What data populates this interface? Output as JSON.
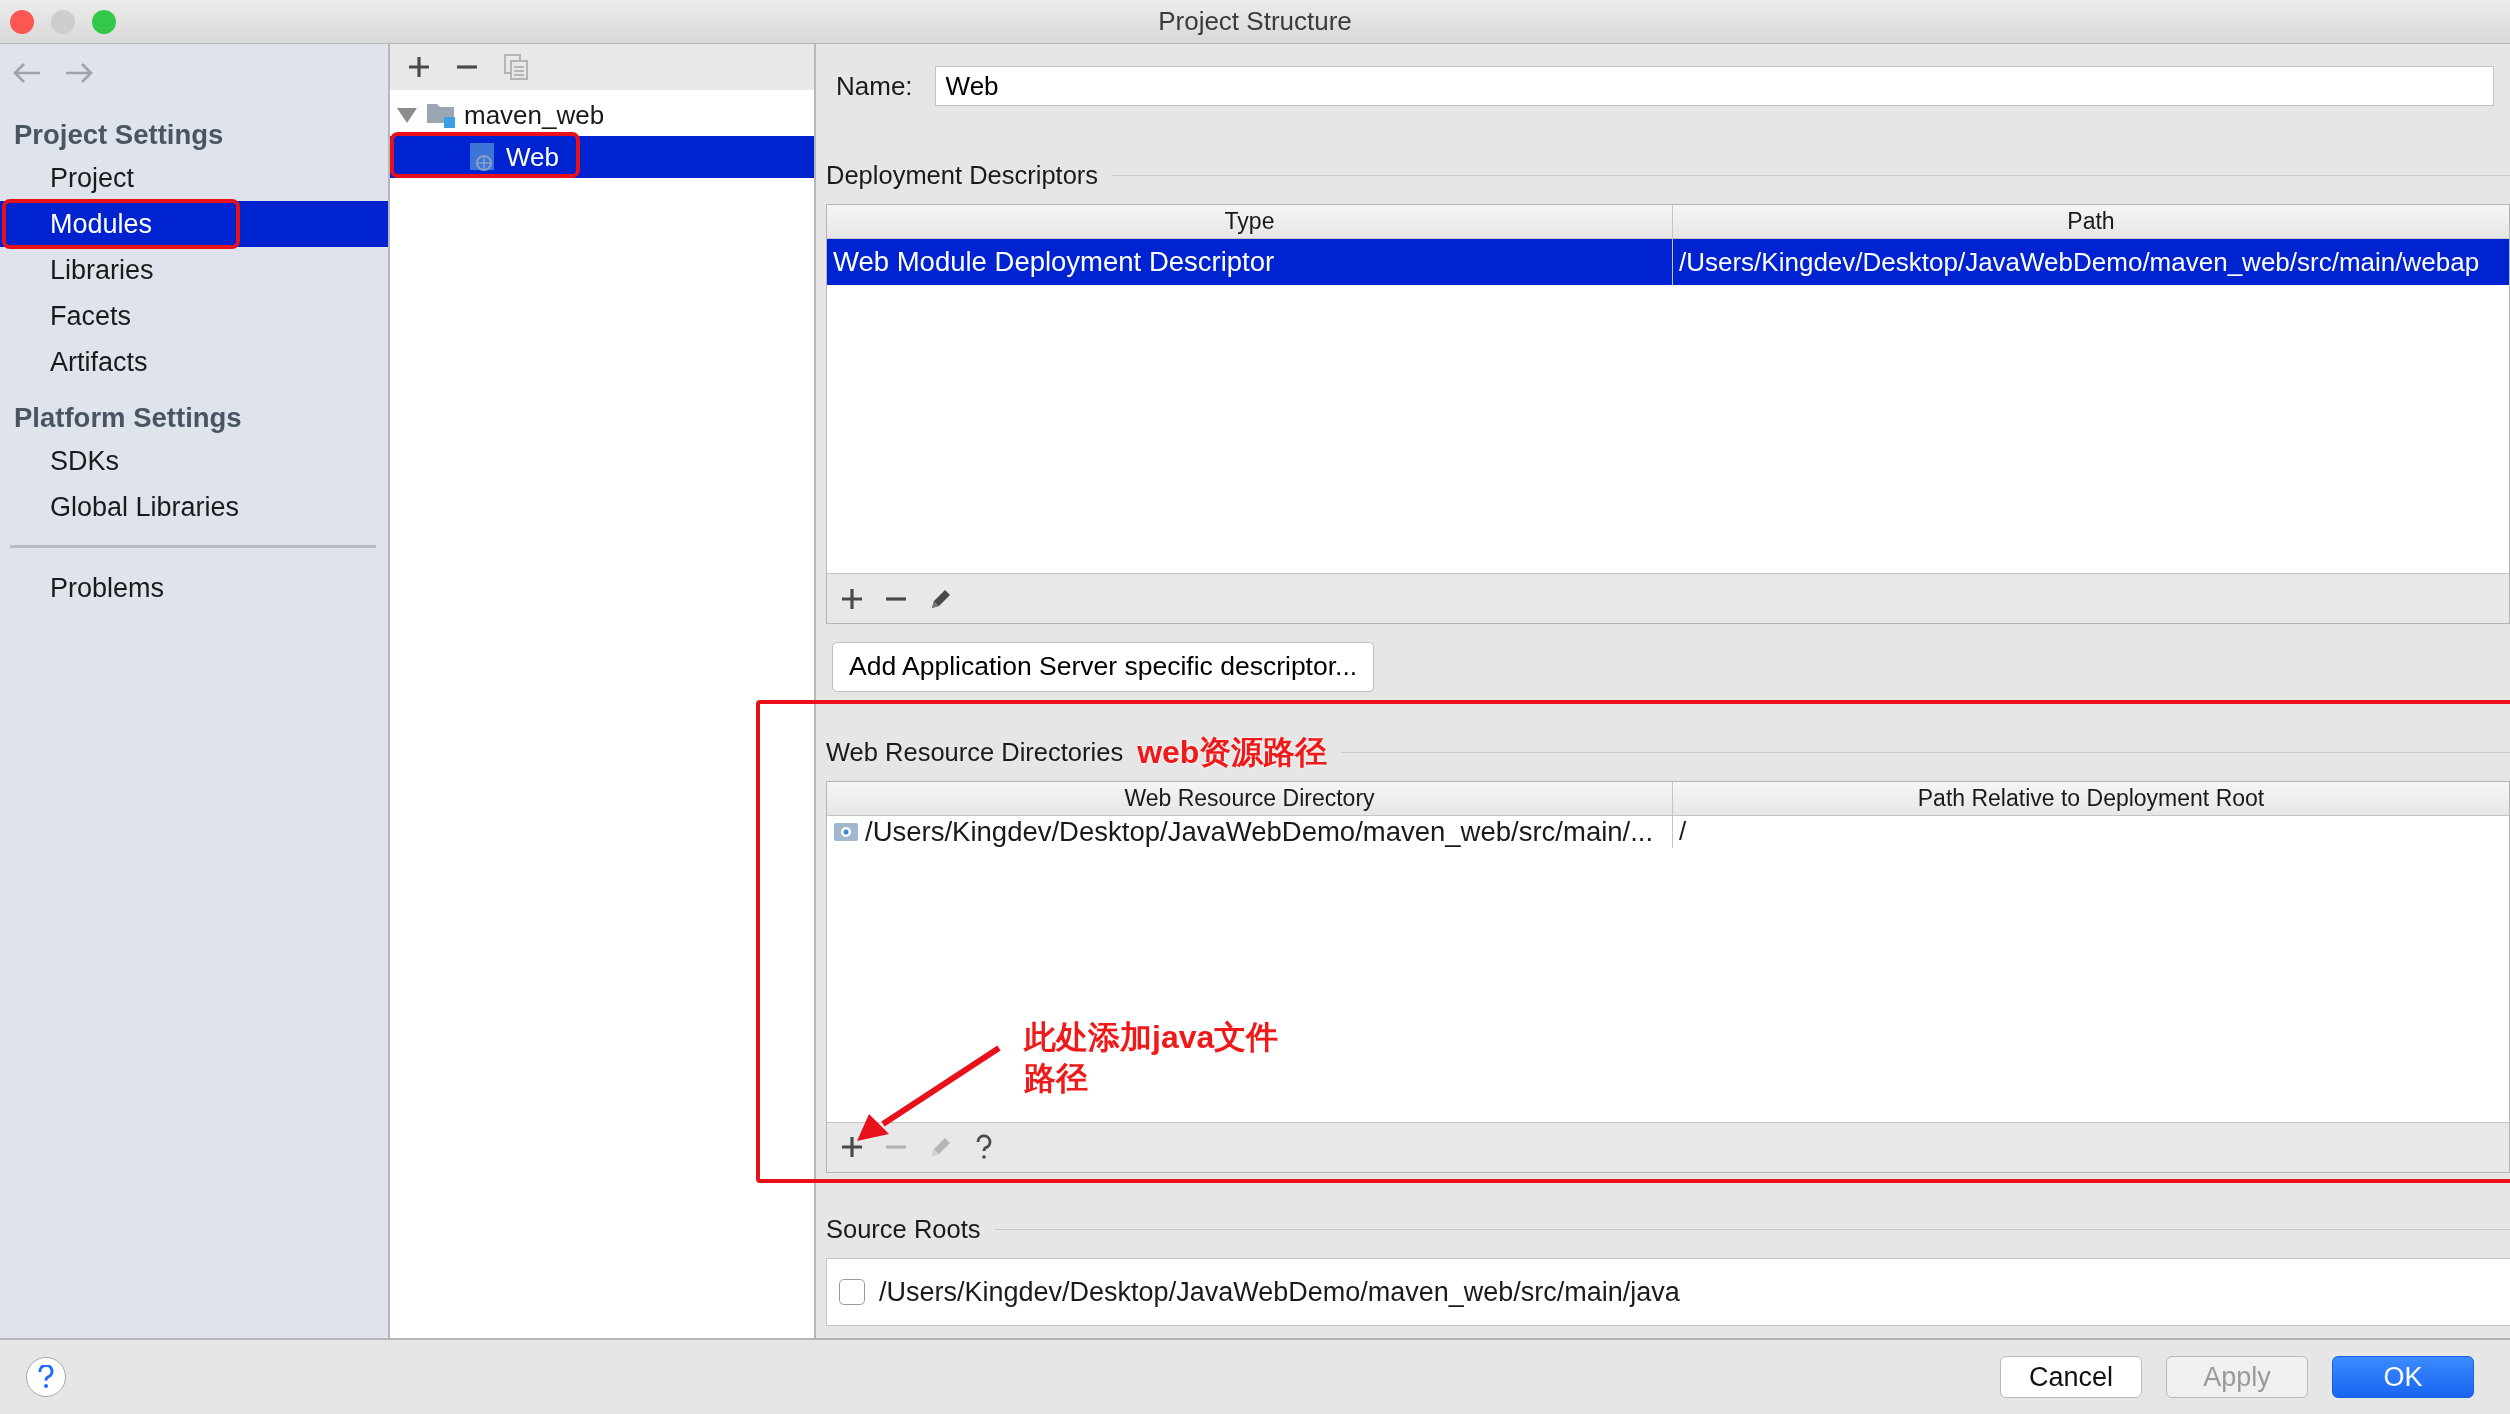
{
  "window": {
    "title": "Project Structure"
  },
  "sidebar": {
    "sections": [
      {
        "heading": "Project Settings",
        "items": [
          {
            "label": "Project",
            "selected": false,
            "highlighted": false
          },
          {
            "label": "Modules",
            "selected": true,
            "highlighted": true
          },
          {
            "label": "Libraries",
            "selected": false,
            "highlighted": false
          },
          {
            "label": "Facets",
            "selected": false,
            "highlighted": false
          },
          {
            "label": "Artifacts",
            "selected": false,
            "highlighted": false
          }
        ]
      },
      {
        "heading": "Platform Settings",
        "items": [
          {
            "label": "SDKs",
            "selected": false,
            "highlighted": false
          },
          {
            "label": "Global Libraries",
            "selected": false,
            "highlighted": false
          }
        ]
      }
    ],
    "footer_items": [
      {
        "label": "Problems",
        "selected": false,
        "highlighted": false
      }
    ]
  },
  "module_toolbar": [
    {
      "kind": "add",
      "disabled": false
    },
    {
      "kind": "remove",
      "disabled": false
    },
    {
      "kind": "copy",
      "disabled": true
    }
  ],
  "module_tree": [
    {
      "label": "maven_web",
      "kind": "module",
      "expanded": true,
      "selected": false,
      "highlighted": false,
      "children": [
        {
          "label": "Web",
          "kind": "web",
          "selected": true,
          "highlighted": true
        }
      ]
    }
  ],
  "name_field": {
    "label": "Name:",
    "value": "Web"
  },
  "deployment_descriptors": {
    "title": "Deployment Descriptors",
    "columns": [
      "Type",
      "Path"
    ],
    "rows": [
      {
        "cells": [
          "Web Module Deployment Descriptor",
          "/Users/Kingdev/Desktop/JavaWebDemo/maven_web/src/main/webap"
        ],
        "selected": true
      }
    ],
    "toolbar": [
      {
        "kind": "add",
        "disabled": false
      },
      {
        "kind": "remove",
        "disabled": false
      },
      {
        "kind": "edit",
        "disabled": false
      }
    ],
    "button": "Add Application Server specific descriptor..."
  },
  "web_resource_directories": {
    "title": "Web Resource Directories",
    "highlighted": true,
    "annotation": "web资源路径",
    "columns": [
      "Web Resource Directory",
      "Path Relative to Deployment Root"
    ],
    "rows": [
      {
        "cells": [
          "/Users/Kingdev/Desktop/JavaWebDemo/maven_web/src/main/...",
          "/"
        ],
        "selected": false
      }
    ],
    "toolbar": [
      {
        "kind": "add",
        "disabled": false
      },
      {
        "kind": "remove",
        "disabled": true
      },
      {
        "kind": "edit",
        "disabled": true
      },
      {
        "kind": "help",
        "disabled": false
      }
    ],
    "note_lines": [
      "此处添加java文件",
      "路径"
    ]
  },
  "source_roots": {
    "title": "Source Roots",
    "items": [
      {
        "path": "/Users/Kingdev/Desktop/JavaWebDemo/maven_web/src/main/java",
        "checked": false
      }
    ]
  },
  "footer_buttons": [
    {
      "label": "Cancel",
      "kind": "default",
      "disabled": false
    },
    {
      "label": "Apply",
      "kind": "default",
      "disabled": true
    },
    {
      "label": "OK",
      "kind": "primary",
      "disabled": false
    }
  ]
}
